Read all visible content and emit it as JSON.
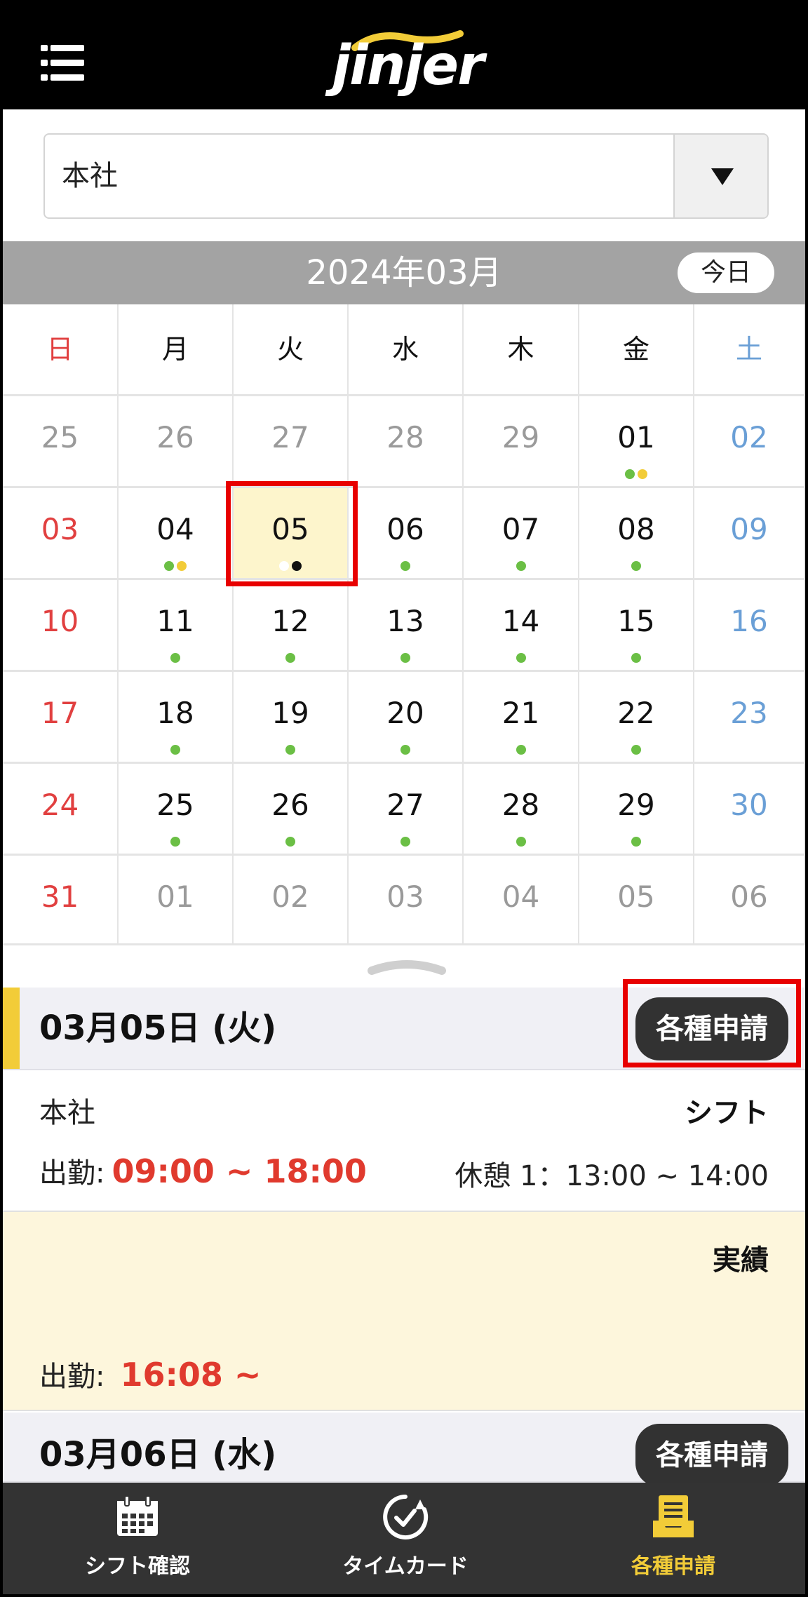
{
  "header": {
    "logo": "jinjer",
    "menu_icon": "menu-icon"
  },
  "site_select": {
    "value": "本社",
    "arrow_icon": "dropdown-triangle-icon"
  },
  "calendar": {
    "month_title": "2024年03月",
    "today_label": "今日",
    "weekdays": [
      "日",
      "月",
      "火",
      "水",
      "木",
      "金",
      "土"
    ],
    "weeks": [
      [
        {
          "d": "25",
          "s": "gray",
          "dots": []
        },
        {
          "d": "26",
          "s": "gray",
          "dots": []
        },
        {
          "d": "27",
          "s": "gray",
          "dots": []
        },
        {
          "d": "28",
          "s": "gray",
          "dots": []
        },
        {
          "d": "29",
          "s": "gray",
          "dots": []
        },
        {
          "d": "01",
          "s": "black",
          "dots": [
            "#6bbf45",
            "#f2cc38"
          ]
        },
        {
          "d": "02",
          "s": "blue",
          "dots": []
        }
      ],
      [
        {
          "d": "03",
          "s": "red",
          "dots": []
        },
        {
          "d": "04",
          "s": "black",
          "dots": [
            "#6bbf45",
            "#f2cc38"
          ]
        },
        {
          "d": "05",
          "s": "black",
          "dots": [
            "#ffffff",
            "#111111"
          ],
          "selected": true
        },
        {
          "d": "06",
          "s": "black",
          "dots": [
            "#6bbf45"
          ]
        },
        {
          "d": "07",
          "s": "black",
          "dots": [
            "#6bbf45"
          ]
        },
        {
          "d": "08",
          "s": "black",
          "dots": [
            "#6bbf45"
          ]
        },
        {
          "d": "09",
          "s": "blue",
          "dots": []
        }
      ],
      [
        {
          "d": "10",
          "s": "red",
          "dots": []
        },
        {
          "d": "11",
          "s": "black",
          "dots": [
            "#6bbf45"
          ]
        },
        {
          "d": "12",
          "s": "black",
          "dots": [
            "#6bbf45"
          ]
        },
        {
          "d": "13",
          "s": "black",
          "dots": [
            "#6bbf45"
          ]
        },
        {
          "d": "14",
          "s": "black",
          "dots": [
            "#6bbf45"
          ]
        },
        {
          "d": "15",
          "s": "black",
          "dots": [
            "#6bbf45"
          ]
        },
        {
          "d": "16",
          "s": "blue",
          "dots": []
        }
      ],
      [
        {
          "d": "17",
          "s": "red",
          "dots": []
        },
        {
          "d": "18",
          "s": "black",
          "dots": [
            "#6bbf45"
          ]
        },
        {
          "d": "19",
          "s": "black",
          "dots": [
            "#6bbf45"
          ]
        },
        {
          "d": "20",
          "s": "black",
          "dots": [
            "#6bbf45"
          ]
        },
        {
          "d": "21",
          "s": "black",
          "dots": [
            "#6bbf45"
          ]
        },
        {
          "d": "22",
          "s": "black",
          "dots": [
            "#6bbf45"
          ]
        },
        {
          "d": "23",
          "s": "blue",
          "dots": []
        }
      ],
      [
        {
          "d": "24",
          "s": "red",
          "dots": []
        },
        {
          "d": "25",
          "s": "black",
          "dots": [
            "#6bbf45"
          ]
        },
        {
          "d": "26",
          "s": "black",
          "dots": [
            "#6bbf45"
          ]
        },
        {
          "d": "27",
          "s": "black",
          "dots": [
            "#6bbf45"
          ]
        },
        {
          "d": "28",
          "s": "black",
          "dots": [
            "#6bbf45"
          ]
        },
        {
          "d": "29",
          "s": "black",
          "dots": [
            "#6bbf45"
          ]
        },
        {
          "d": "30",
          "s": "blue",
          "dots": []
        }
      ],
      [
        {
          "d": "31",
          "s": "red",
          "dots": []
        },
        {
          "d": "01",
          "s": "gray",
          "dots": []
        },
        {
          "d": "02",
          "s": "gray",
          "dots": []
        },
        {
          "d": "03",
          "s": "gray",
          "dots": []
        },
        {
          "d": "04",
          "s": "gray",
          "dots": []
        },
        {
          "d": "05",
          "s": "gray",
          "dots": []
        },
        {
          "d": "06",
          "s": "gray",
          "dots": []
        }
      ]
    ]
  },
  "detail": {
    "selected_date": "03月05日 (火)",
    "request_button": "各種申請",
    "site": "本社",
    "shift_label": "シフト",
    "work_label": "出勤:",
    "work_time": "09:00 ~ 18:00",
    "break_text": "休憩 1：13:00 ~ 14:00",
    "actual_label": "実績",
    "actual_work_label": "出勤:",
    "actual_work_time": "16:08 ~",
    "next_date": "03月06日 (水)",
    "next_request_button": "各種申請"
  },
  "bottom_nav": {
    "items": [
      {
        "label": "シフト確認",
        "icon": "calendar-icon"
      },
      {
        "label": "タイムカード",
        "icon": "clock-icon"
      },
      {
        "label": "各種申請",
        "icon": "document-tray-icon"
      }
    ]
  },
  "colors": {
    "accent": "#f2cc38",
    "highlight_border": "#e80000",
    "time_red": "#e03a2e",
    "sunday": "#e14040",
    "saturday": "#6a9fd6"
  }
}
